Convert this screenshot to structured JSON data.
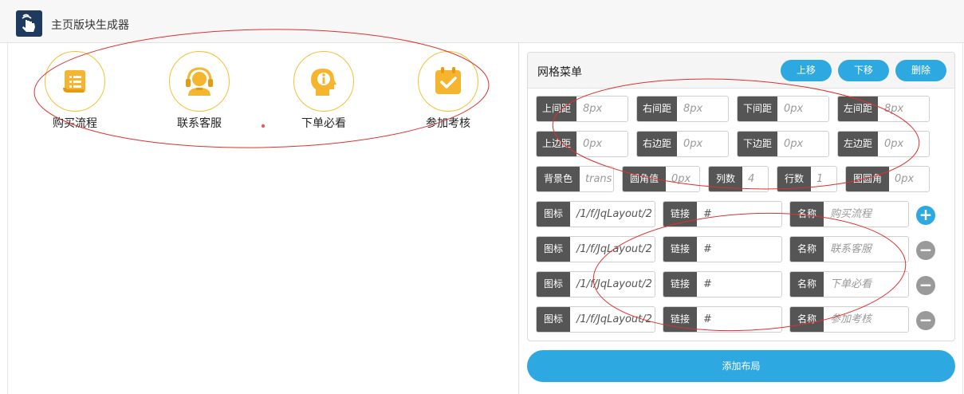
{
  "app": {
    "title": "主页版块生成器"
  },
  "preview": {
    "items": [
      {
        "label": "购买流程",
        "icon": "scroll-icon"
      },
      {
        "label": "联系客服",
        "icon": "customer-service-icon"
      },
      {
        "label": "下单必看",
        "icon": "info-head-icon"
      },
      {
        "label": "参加考核",
        "icon": "checklist-icon"
      }
    ]
  },
  "panel": {
    "title": "网格菜单",
    "buttons": {
      "up": "上移",
      "down": "下移",
      "delete": "删除"
    },
    "margin": {
      "top": {
        "label": "上间距",
        "value": "8px"
      },
      "right": {
        "label": "右间距",
        "value": "8px"
      },
      "bottom": {
        "label": "下间距",
        "value": "0px"
      },
      "left": {
        "label": "左间距",
        "value": "8px"
      }
    },
    "padding": {
      "top": {
        "label": "上边距",
        "value": "0px"
      },
      "right": {
        "label": "右边距",
        "value": "0px"
      },
      "bottom": {
        "label": "下边距",
        "value": "0px"
      },
      "left": {
        "label": "左边距",
        "value": "0px"
      }
    },
    "style": {
      "bg": {
        "label": "背景色",
        "value": "trans"
      },
      "radius": {
        "label": "圆角值",
        "value": "0px"
      },
      "cols": {
        "label": "列数",
        "value": "4"
      },
      "rows": {
        "label": "行数",
        "value": "1"
      },
      "icon_radius": {
        "label": "图圆角",
        "value": "0px"
      }
    },
    "items_labels": {
      "icon": "图标",
      "link": "链接",
      "name": "名称"
    },
    "items": [
      {
        "icon": "/1/f/JqLayout/2",
        "link": "#",
        "name": "购买流程",
        "action": "+"
      },
      {
        "icon": "/1/f/JqLayout/2",
        "link": "#",
        "name": "联系客服",
        "action": "−"
      },
      {
        "icon": "/1/f/JqLayout/2",
        "link": "#",
        "name": "下单必看",
        "action": "−"
      },
      {
        "icon": "/1/f/JqLayout/2",
        "link": "#",
        "name": "参加考核",
        "action": "−"
      }
    ]
  },
  "add_layout": "添加布局",
  "colors": {
    "accent": "#2ea8e0",
    "icon_yellow": "#f5b52e",
    "label_dark": "#555555",
    "annotation": "#e03030"
  }
}
